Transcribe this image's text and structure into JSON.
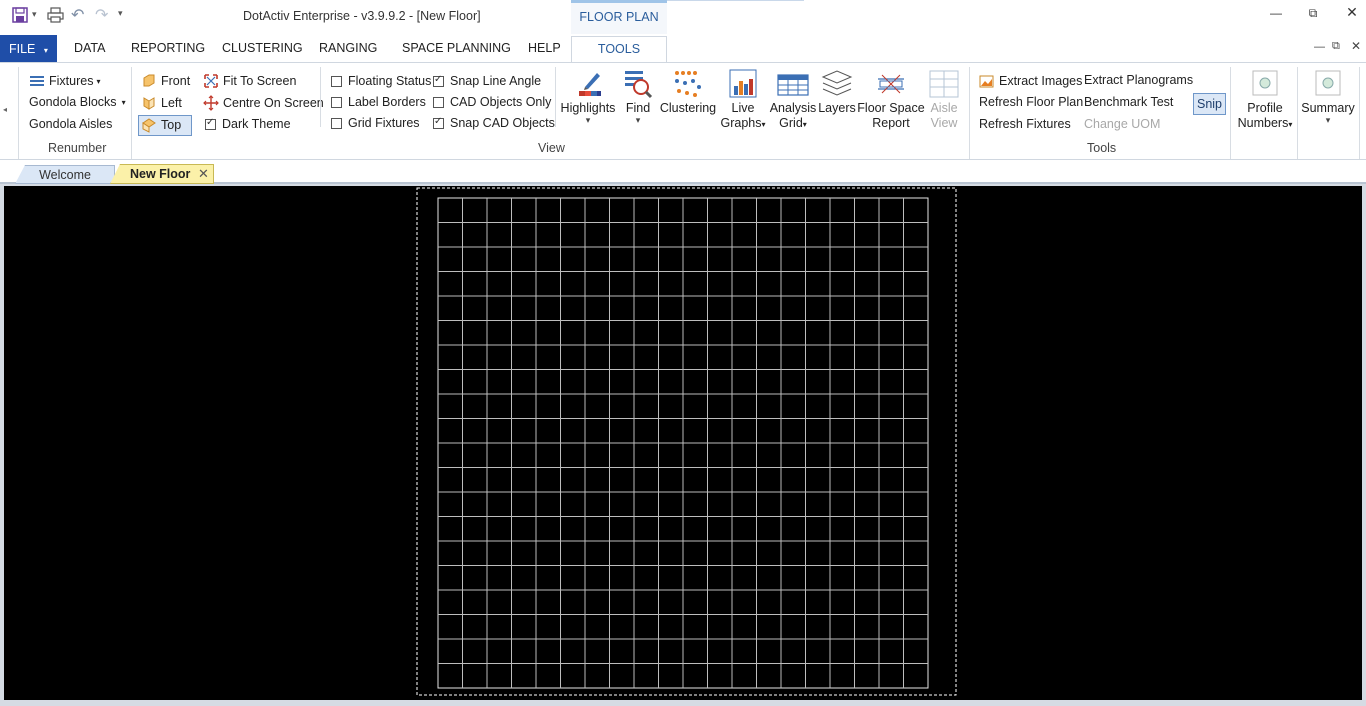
{
  "window": {
    "title": "DotActiv Enterprise - v3.9.9.2 - [New Floor]",
    "context_tab": "FLOOR PLAN"
  },
  "menu": {
    "file": "FILE",
    "tabs": [
      "DATA",
      "REPORTING",
      "CLUSTERING",
      "RANGING",
      "SPACE PLANNING",
      "HELP",
      "TOOLS"
    ]
  },
  "ribbon": {
    "renumber": {
      "items": [
        "Fixtures",
        "Gondola Blocks",
        "Gondola Aisles"
      ],
      "label": "Renumber"
    },
    "view": {
      "views": [
        "Front",
        "Left",
        "Top"
      ],
      "screen": [
        "Fit To Screen",
        "Centre On Screen"
      ],
      "dark_theme": {
        "label": "Dark Theme",
        "checked": true
      },
      "checks_col1": [
        {
          "label": "Floating Status",
          "checked": false
        },
        {
          "label": "Label Borders",
          "checked": false
        },
        {
          "label": "Grid Fixtures",
          "checked": false
        }
      ],
      "checks_col2": [
        {
          "label": "Snap Line Angle",
          "checked": true
        },
        {
          "label": "CAD Objects Only",
          "checked": false
        },
        {
          "label": "Snap CAD Objects",
          "checked": true
        }
      ],
      "big_buttons": {
        "highlights": "Highlights",
        "find": "Find",
        "clustering": "Clustering",
        "live_graphs_1": "Live",
        "live_graphs_2": "Graphs",
        "analysis_grid_1": "Analysis",
        "analysis_grid_2": "Grid",
        "layers": "Layers",
        "floor_space_1": "Floor Space",
        "floor_space_2": "Report",
        "aisle_view_1": "Aisle",
        "aisle_view_2": "View"
      },
      "label": "View"
    },
    "tools": {
      "col1": [
        "Extract Images",
        "Refresh Floor Plan",
        "Refresh Fixtures"
      ],
      "col2": [
        "Extract Planograms",
        "Benchmark Test",
        "Change UOM"
      ],
      "snip": "Snip",
      "label": "Tools"
    },
    "profile_numbers_1": "Profile",
    "profile_numbers_2": "Numbers",
    "summary": "Summary"
  },
  "doc_tabs": {
    "welcome": "Welcome",
    "new_floor": "New Floor"
  },
  "floor": {
    "grid_cols": 20,
    "grid_rows": 20
  }
}
